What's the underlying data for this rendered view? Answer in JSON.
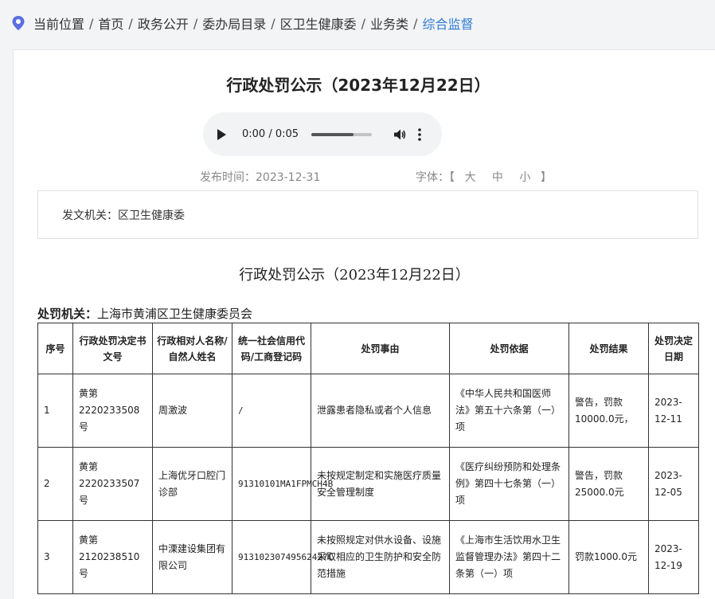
{
  "breadcrumb": {
    "items": [
      "当前位置",
      "首页",
      "政务公开",
      "委办局目录",
      "区卫生健康委",
      "业务类"
    ],
    "current": "综合监督",
    "separator": "/"
  },
  "article": {
    "title": "行政处罚公示（2023年12月22日）",
    "audio": {
      "time": "0:00 / 0:05",
      "progress": 0.7
    },
    "publish_time": "发布时间：2023-12-31",
    "font_size": {
      "label": "字体：【",
      "large": "大",
      "medium": "中",
      "small": "小",
      "close": "】"
    },
    "issuer": "发文机关：区卫生健康委",
    "subtitle": "行政处罚公示（2023年12月22日）",
    "authority_label": "处罚机关：",
    "authority_value": "上海市黄浦区卫生健康委员会"
  },
  "table": {
    "headers": [
      "序号",
      "行政处罚决定书文号",
      "行政相对人名称/自然人姓名",
      "统一社会信用代码/工商登记码",
      "处罚事由",
      "处罚依据",
      "处罚结果",
      "处罚决定日期"
    ],
    "rows": [
      [
        "1",
        "黄第2220233508号",
        "周激波",
        "/",
        "泄露患者隐私或者个人信息",
        "《中华人民共和国医师法》第五十六条第（一）项",
        "警告，罚款10000.0元，",
        "2023-12-11"
      ],
      [
        "2",
        "黄第2220233507号",
        "上海优牙口腔门诊部",
        "91310101MA1FPMCH4B",
        "未按规定制定和实施医疗质量安全管理制度",
        "《医疗纠纷预防和处理条例》第四十七条第（一）项",
        "警告，罚款25000.0元",
        "2023-12-05"
      ],
      [
        "3",
        "黄第2120238510号",
        "中溧建设集团有限公司",
        "91310230749562427C",
        "未按照规定对供水设备、设施采取相应的卫生防护和安全防范措施",
        "《上海市生活饮用水卫生监督管理办法》第四十二条第（一）项",
        "罚款1000.0元",
        "2023-12-19"
      ]
    ]
  },
  "colors": {
    "accent": "#2f7bd6",
    "pin": "#5b6ee1"
  }
}
